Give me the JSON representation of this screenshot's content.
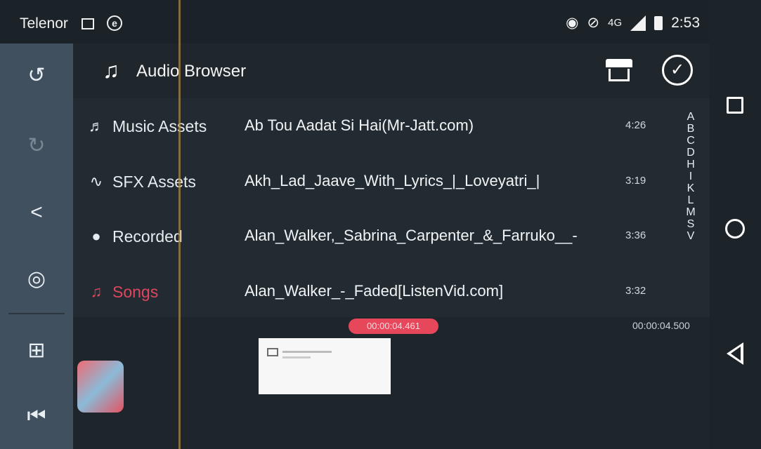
{
  "status_bar": {
    "carrier": "Telenor",
    "network": "4G",
    "time": "2:53",
    "icons": [
      "image-icon",
      "e-icon",
      "hotspot-icon",
      "dnd-icon",
      "signal-icon",
      "battery-icon"
    ]
  },
  "header": {
    "title": "Audio Browser",
    "note_icon": "♫",
    "check_icon": "✓"
  },
  "categories": [
    {
      "label": "Music Assets",
      "icon": "♬"
    },
    {
      "label": "SFX Assets",
      "icon": "∿"
    },
    {
      "label": "Recorded",
      "icon": "●"
    },
    {
      "label": "Songs",
      "icon": "♫"
    }
  ],
  "tracks": [
    {
      "title": "Ab Tou Aadat Si Hai(Mr-Jatt.com)",
      "duration": "4:26"
    },
    {
      "title": "Akh_Lad_Jaave_With_Lyrics_|_Loveyatri_|",
      "duration": "3:19"
    },
    {
      "title": "Alan_Walker,_Sabrina_Carpenter_&_Farruko__-",
      "duration": "3:36"
    },
    {
      "title": "Alan_Walker_-_Faded[ListenVid.com]",
      "duration": "3:32"
    }
  ],
  "index_letters": [
    "A",
    "B",
    "C",
    "D",
    "H",
    "I",
    "K",
    "L",
    "M",
    "S",
    "V"
  ],
  "timeline": {
    "current_time": "00:00:04.461",
    "total_time": "00:00:04.500"
  },
  "rail": {
    "undo_icon": "↺",
    "redo_icon": "↻",
    "share_icon": "<",
    "settings_icon": "◎",
    "adjust_icon": "⊞",
    "skip_start_icon": "⏮"
  },
  "colors": {
    "accent": "#e0465f",
    "panel": "#222b31",
    "rail": "#40505e"
  }
}
